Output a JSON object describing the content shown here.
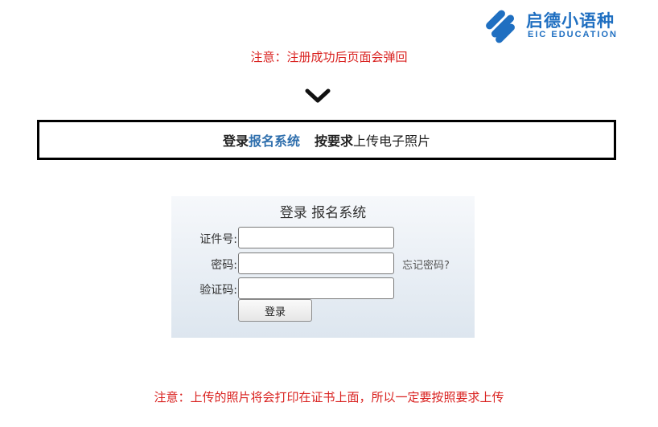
{
  "logo": {
    "name_cn": "启德小语种",
    "name_en": "EIC EDUCATION",
    "brand_color": "#1f6fc1",
    "icon": "eic-logo-icon"
  },
  "notice_top": "注意：注册成功后页面会弹回",
  "chevron_icon": "chevron-down-icon",
  "banner": {
    "part1": "登录",
    "part2": "报名系统",
    "part3": "按要求",
    "part4": "上传电子照片",
    "accent_color": "#2f6fad"
  },
  "login": {
    "title": "登录 报名系统",
    "id_label": "证件号:",
    "id_value": "",
    "password_label": "密码:",
    "password_value": "",
    "captcha_label": "验证码:",
    "captcha_value": "",
    "forgot_link": "忘记密码?",
    "submit_label": "登录"
  },
  "notice_bottom": "注意：上传的照片将会打印在证书上面，所以一定要按照要求上传",
  "notice_color": "#d9211f"
}
